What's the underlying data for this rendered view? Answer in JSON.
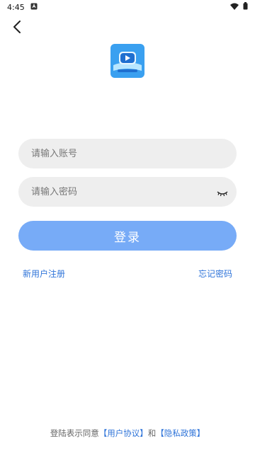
{
  "status_bar": {
    "time": "4:45"
  },
  "icons": {
    "back": "chevron-left-icon",
    "app_logo": "video-play-logo",
    "password_visibility": "eye-closed-icon"
  },
  "login_form": {
    "username_placeholder": "请输入账号",
    "password_placeholder": "请输入密码",
    "login_label": "登录"
  },
  "links": {
    "register": "新用户注册",
    "forgot_password": "忘记密码"
  },
  "agreement": {
    "prefix": "登陆表示同意",
    "user_agreement": "【用户协议】",
    "conjunction": "和",
    "privacy_policy": "【隐私政策】"
  },
  "colors": {
    "accent": "#77abf7",
    "link": "#2f74d9",
    "field_bg": "#eeeeee"
  }
}
